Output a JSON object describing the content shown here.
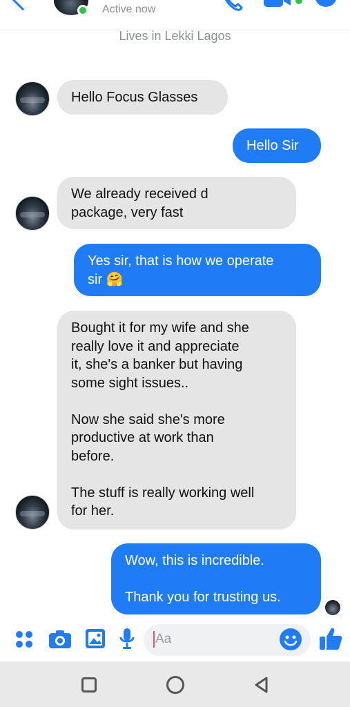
{
  "header": {
    "status": "Active now",
    "about": "Lives in Lekki Lagos"
  },
  "messages": [
    {
      "from": "them",
      "text": "Hello Focus Glasses"
    },
    {
      "from": "me",
      "text": "Hello Sir"
    },
    {
      "from": "them",
      "text": "We already received d\npackage, very fast"
    },
    {
      "from": "me",
      "text": "Yes sir, that is how we operate\nsir 🤗"
    },
    {
      "from": "them",
      "text": "Bought it for my wife and she\nreally love it and appreciate\nit, she's a banker but having\nsome sight issues..\n\nNow she said she's more\nproductive at work than\nbefore.\n\nThe stuff is really working well\nfor her."
    },
    {
      "from": "me",
      "text": "Wow, this is incredible.\n\nThank you for trusting us."
    }
  ],
  "composer": {
    "placeholder": "Aa",
    "icons": [
      "menu-dots-icon",
      "camera-icon",
      "gallery-icon",
      "microphone-icon",
      "emoji-icon",
      "thumbs-up-icon"
    ]
  },
  "colors": {
    "accent": "#1f7cf5",
    "incoming_bubble": "#e5e5e6",
    "active_green": "#31c24a"
  }
}
